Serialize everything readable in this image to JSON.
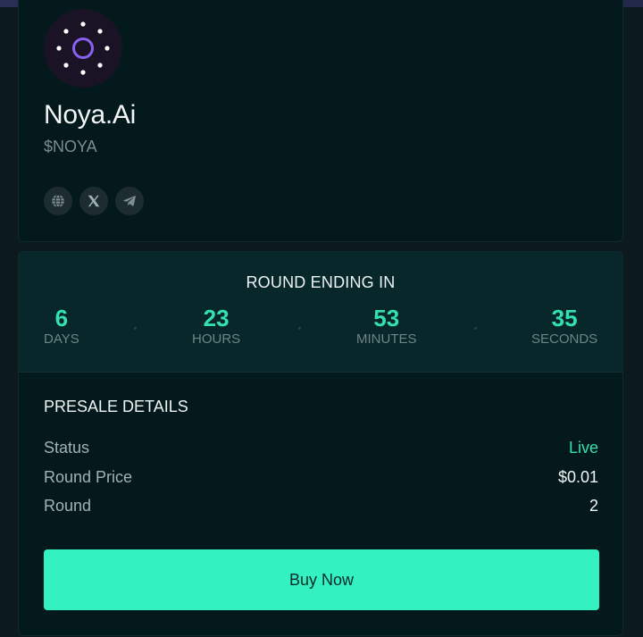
{
  "project": {
    "name": "Noya.Ai",
    "ticker": "$NOYA",
    "logo_icon": "noya-logo-icon",
    "socials": [
      {
        "icon": "globe-icon"
      },
      {
        "icon": "x-icon"
      },
      {
        "icon": "telegram-icon"
      }
    ]
  },
  "countdown": {
    "title": "ROUND ENDING IN",
    "days": {
      "value": "6",
      "label": "DAYS"
    },
    "hours": {
      "value": "23",
      "label": "HOURS"
    },
    "minutes": {
      "value": "53",
      "label": "MINUTES"
    },
    "seconds": {
      "value": "35",
      "label": "SECONDS"
    }
  },
  "presale": {
    "title": "PRESALE DETAILS",
    "rows": [
      {
        "label": "Status",
        "value": "Live"
      },
      {
        "label": "Round Price",
        "value": "$0.01"
      },
      {
        "label": "Round",
        "value": "2"
      }
    ],
    "buy_label": "Buy Now"
  },
  "colors": {
    "accent": "#34e0b0",
    "button": "#33f2bf",
    "logo_ring": "#8a62f0"
  }
}
